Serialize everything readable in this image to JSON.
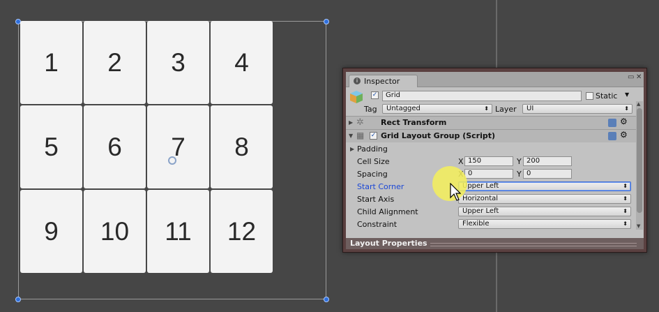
{
  "scene": {
    "cells": [
      "1",
      "2",
      "3",
      "4",
      "5",
      "6",
      "7",
      "8",
      "9",
      "10",
      "11",
      "12"
    ]
  },
  "inspector": {
    "tab_label": "Inspector",
    "object": {
      "active": true,
      "name": "Grid",
      "static_label": "Static",
      "static_checked": false,
      "tag_label": "Tag",
      "tag_value": "Untagged",
      "layer_label": "Layer",
      "layer_value": "UI"
    },
    "rect_transform": {
      "title": "Rect Transform"
    },
    "grid_layout": {
      "title": "Grid Layout Group (Script)",
      "enabled": true,
      "padding_label": "Padding",
      "cell_size": {
        "label": "Cell Size",
        "x_label": "X",
        "x": "150",
        "y_label": "Y",
        "y": "200"
      },
      "spacing": {
        "label": "Spacing",
        "x_label": "X",
        "x": "0",
        "y_label": "Y",
        "y": "0"
      },
      "start_corner": {
        "label": "Start Corner",
        "value": "Upper Left"
      },
      "start_axis": {
        "label": "Start Axis",
        "value": "Horizontal"
      },
      "child_alignment": {
        "label": "Child Alignment",
        "value": "Upper Left"
      },
      "constraint": {
        "label": "Constraint",
        "value": "Flexible"
      }
    },
    "layout_properties": "Layout Properties"
  },
  "colors": {
    "background": "#464646",
    "cell": "#f3f3f3",
    "handle": "#2f6fdc",
    "highlight_label": "#1b47d6",
    "cursor_glow": "#f5f05a"
  }
}
